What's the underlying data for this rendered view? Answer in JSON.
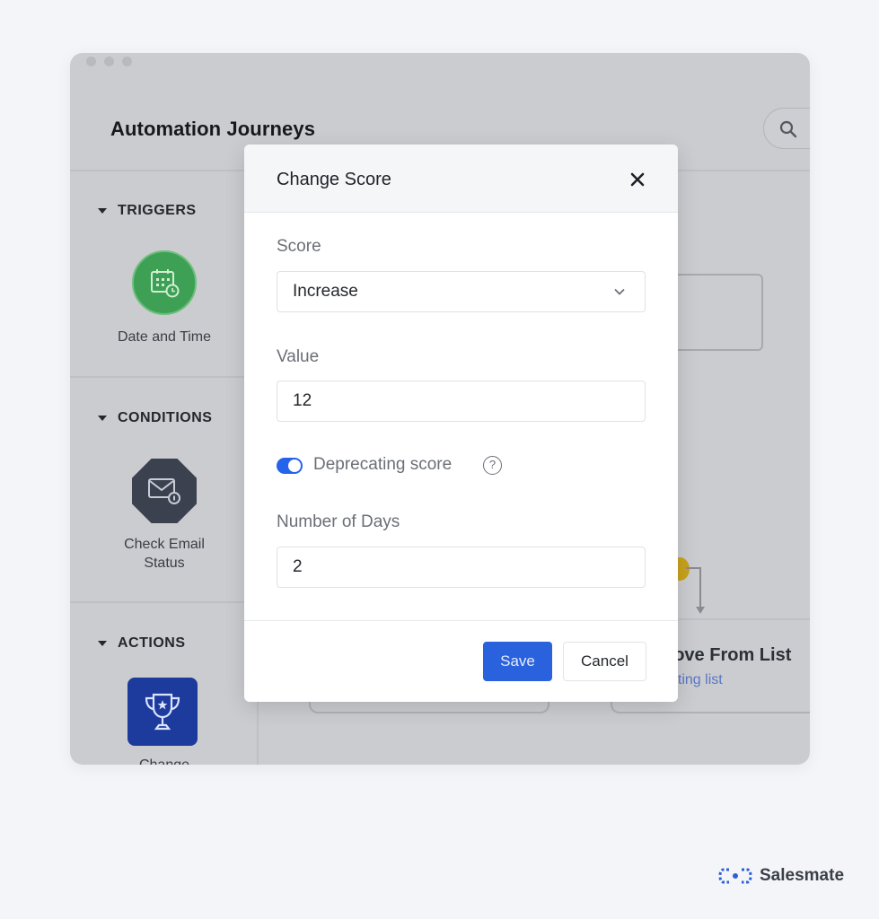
{
  "window": {
    "app_title": "Automation Journeys",
    "search_icon": "search-icon"
  },
  "sidebar": {
    "sections": [
      {
        "title": "TRIGGERS",
        "item": {
          "label": "Date and Time",
          "icon": "calendar-clock-icon",
          "color": "#3ea055"
        }
      },
      {
        "title": "CONDITIONS",
        "item": {
          "label_line1": "Check Email",
          "label_line2": "Status",
          "icon": "envelope-info-icon",
          "color": "#3b414f"
        }
      },
      {
        "title": "ACTIONS",
        "item": {
          "label": "Change",
          "icon": "trophy-icon",
          "color": "#1c3b9c"
        }
      }
    ]
  },
  "canvas": {
    "action_title": "nove From List",
    "action_subtitle": "eting list"
  },
  "modal": {
    "title": "Change Score",
    "close_icon": "close-icon",
    "score": {
      "label": "Score",
      "value": "Increase"
    },
    "value": {
      "label": "Value",
      "value": "12"
    },
    "deprecating": {
      "label": "Deprecating score",
      "enabled": true,
      "help": "?"
    },
    "days": {
      "label": "Number of Days",
      "value": "2"
    },
    "save_label": "Save",
    "cancel_label": "Cancel",
    "accent_color": "#2a62dd"
  },
  "brand": {
    "name": "Salesmate"
  }
}
